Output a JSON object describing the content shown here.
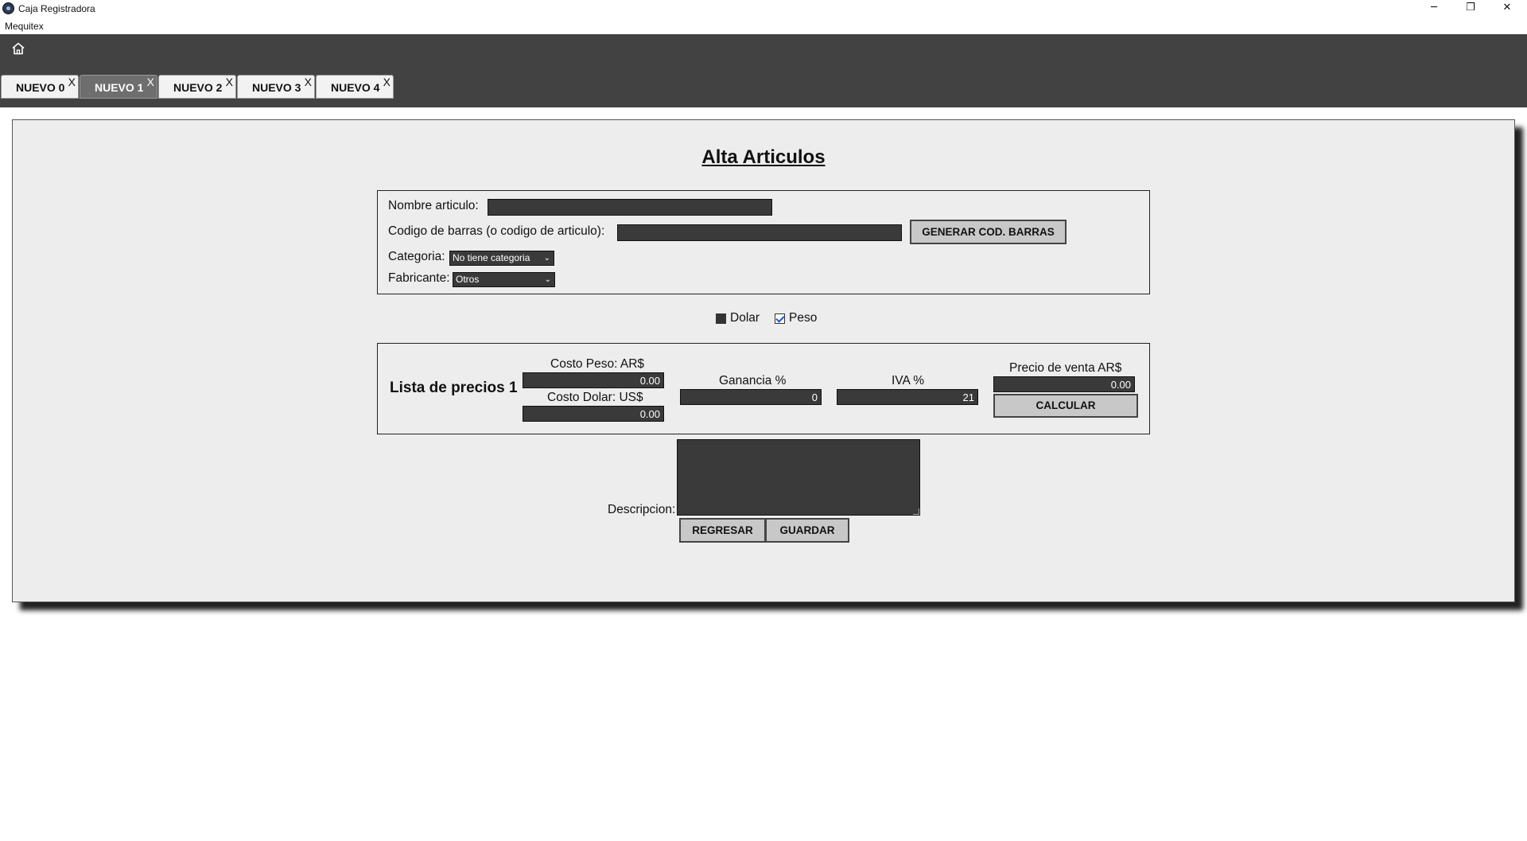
{
  "window": {
    "title": "Caja Registradora",
    "subtitle": "Mequitex",
    "controls": {
      "minimize": "─",
      "maximize": "❐",
      "close": "✕"
    }
  },
  "toolbar": {
    "home_icon": "home-icon",
    "tabs": [
      {
        "label": "NUEVO 0",
        "close": "X",
        "active": false
      },
      {
        "label": "NUEVO 1",
        "close": "X",
        "active": true
      },
      {
        "label": "NUEVO 2",
        "close": "X",
        "active": false
      },
      {
        "label": "NUEVO 3",
        "close": "X",
        "active": false
      },
      {
        "label": "NUEVO 4",
        "close": "X",
        "active": false
      }
    ]
  },
  "form": {
    "title": "Alta Articulos",
    "nombre_label": "Nombre articulo:",
    "nombre_value": "",
    "codigo_label": "Codigo de barras (o codigo de articulo):",
    "codigo_value": "",
    "generar_button": "GENERAR COD. BARRAS",
    "categoria_label": "Categoria:",
    "categoria_value": "No tiene categoria",
    "fabricante_label": "Fabricante:",
    "fabricante_value": "Otros",
    "currency": {
      "dolar_label": "Dolar",
      "dolar_checked": false,
      "peso_label": "Peso",
      "peso_checked": true
    },
    "prices": {
      "list_title": "Lista de precios 1",
      "costo_peso_label": "Costo Peso: AR$",
      "costo_peso_value": "0.00",
      "costo_dolar_label": "Costo Dolar: US$",
      "costo_dolar_value": "0.00",
      "ganancia_label": "Ganancia %",
      "ganancia_value": "0",
      "iva_label": "IVA %",
      "iva_value": "21",
      "precio_venta_label": "Precio de venta AR$",
      "precio_venta_value": "0.00",
      "calcular_button": "CALCULAR"
    },
    "descripcion_label": "Descripcion:",
    "descripcion_value": "",
    "regresar_button": "REGRESAR",
    "guardar_button": "GUARDAR"
  },
  "colors": {
    "toolbar_bg": "#424242",
    "panel_bg": "#ededed",
    "field_bg": "#3a3a3a",
    "button_bg": "#c8c8c8",
    "active_tab_bg": "#6e6e6e"
  }
}
